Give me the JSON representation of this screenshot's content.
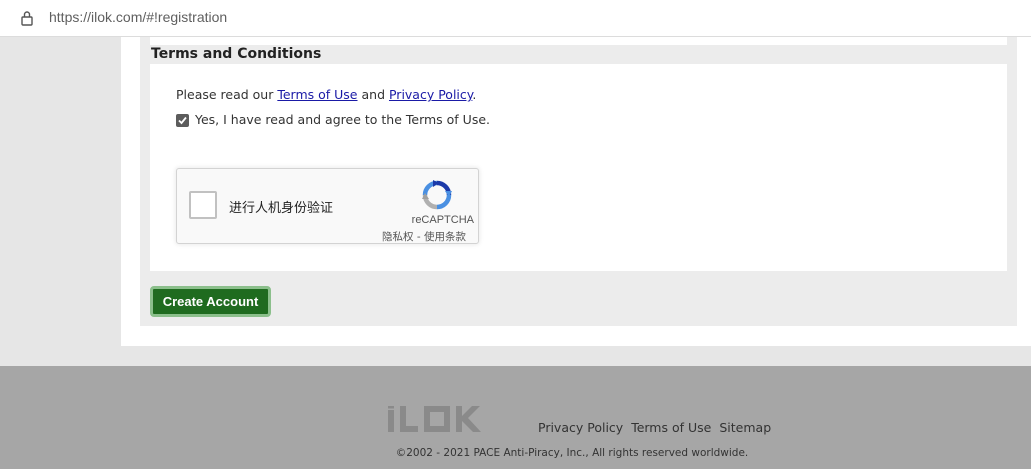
{
  "browser": {
    "url": "https://ilok.com/#!registration"
  },
  "terms": {
    "title": "Terms and Conditions",
    "read_prefix": "Please read our ",
    "terms_link": "Terms of Use",
    "and": " and ",
    "privacy_link": "Privacy Policy",
    "period": ".",
    "agree_label": "Yes, I have read and agree to the Terms of Use.",
    "agree_checked": true
  },
  "recaptcha": {
    "label": "进行人机身份验证",
    "brand": "reCAPTCHA",
    "links": "隐私权 - 使用条款"
  },
  "actions": {
    "create_account": "Create Account"
  },
  "footer": {
    "logo_text": "iLOK",
    "links": [
      "Privacy Policy",
      "Terms of Use",
      "Sitemap"
    ],
    "copyright": "©2002 - 2021 PACE Anti-Piracy, Inc., All rights reserved worldwide."
  },
  "colors": {
    "button_bg": "#1f6b1f",
    "link": "#1a1aa6",
    "footer_bg": "#a6a6a6"
  }
}
